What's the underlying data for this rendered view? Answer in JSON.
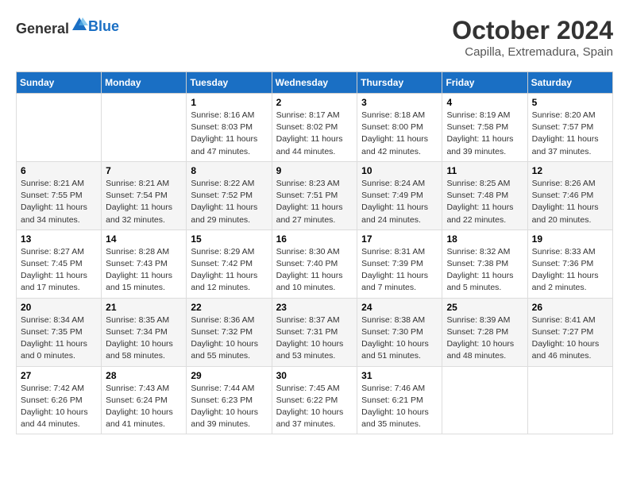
{
  "header": {
    "logo_general": "General",
    "logo_blue": "Blue",
    "month": "October 2024",
    "location": "Capilla, Extremadura, Spain"
  },
  "days_of_week": [
    "Sunday",
    "Monday",
    "Tuesday",
    "Wednesday",
    "Thursday",
    "Friday",
    "Saturday"
  ],
  "weeks": [
    [
      {
        "day": "",
        "sunrise": "",
        "sunset": "",
        "daylight": ""
      },
      {
        "day": "",
        "sunrise": "",
        "sunset": "",
        "daylight": ""
      },
      {
        "day": "1",
        "sunrise": "Sunrise: 8:16 AM",
        "sunset": "Sunset: 8:03 PM",
        "daylight": "Daylight: 11 hours and 47 minutes."
      },
      {
        "day": "2",
        "sunrise": "Sunrise: 8:17 AM",
        "sunset": "Sunset: 8:02 PM",
        "daylight": "Daylight: 11 hours and 44 minutes."
      },
      {
        "day": "3",
        "sunrise": "Sunrise: 8:18 AM",
        "sunset": "Sunset: 8:00 PM",
        "daylight": "Daylight: 11 hours and 42 minutes."
      },
      {
        "day": "4",
        "sunrise": "Sunrise: 8:19 AM",
        "sunset": "Sunset: 7:58 PM",
        "daylight": "Daylight: 11 hours and 39 minutes."
      },
      {
        "day": "5",
        "sunrise": "Sunrise: 8:20 AM",
        "sunset": "Sunset: 7:57 PM",
        "daylight": "Daylight: 11 hours and 37 minutes."
      }
    ],
    [
      {
        "day": "6",
        "sunrise": "Sunrise: 8:21 AM",
        "sunset": "Sunset: 7:55 PM",
        "daylight": "Daylight: 11 hours and 34 minutes."
      },
      {
        "day": "7",
        "sunrise": "Sunrise: 8:21 AM",
        "sunset": "Sunset: 7:54 PM",
        "daylight": "Daylight: 11 hours and 32 minutes."
      },
      {
        "day": "8",
        "sunrise": "Sunrise: 8:22 AM",
        "sunset": "Sunset: 7:52 PM",
        "daylight": "Daylight: 11 hours and 29 minutes."
      },
      {
        "day": "9",
        "sunrise": "Sunrise: 8:23 AM",
        "sunset": "Sunset: 7:51 PM",
        "daylight": "Daylight: 11 hours and 27 minutes."
      },
      {
        "day": "10",
        "sunrise": "Sunrise: 8:24 AM",
        "sunset": "Sunset: 7:49 PM",
        "daylight": "Daylight: 11 hours and 24 minutes."
      },
      {
        "day": "11",
        "sunrise": "Sunrise: 8:25 AM",
        "sunset": "Sunset: 7:48 PM",
        "daylight": "Daylight: 11 hours and 22 minutes."
      },
      {
        "day": "12",
        "sunrise": "Sunrise: 8:26 AM",
        "sunset": "Sunset: 7:46 PM",
        "daylight": "Daylight: 11 hours and 20 minutes."
      }
    ],
    [
      {
        "day": "13",
        "sunrise": "Sunrise: 8:27 AM",
        "sunset": "Sunset: 7:45 PM",
        "daylight": "Daylight: 11 hours and 17 minutes."
      },
      {
        "day": "14",
        "sunrise": "Sunrise: 8:28 AM",
        "sunset": "Sunset: 7:43 PM",
        "daylight": "Daylight: 11 hours and 15 minutes."
      },
      {
        "day": "15",
        "sunrise": "Sunrise: 8:29 AM",
        "sunset": "Sunset: 7:42 PM",
        "daylight": "Daylight: 11 hours and 12 minutes."
      },
      {
        "day": "16",
        "sunrise": "Sunrise: 8:30 AM",
        "sunset": "Sunset: 7:40 PM",
        "daylight": "Daylight: 11 hours and 10 minutes."
      },
      {
        "day": "17",
        "sunrise": "Sunrise: 8:31 AM",
        "sunset": "Sunset: 7:39 PM",
        "daylight": "Daylight: 11 hours and 7 minutes."
      },
      {
        "day": "18",
        "sunrise": "Sunrise: 8:32 AM",
        "sunset": "Sunset: 7:38 PM",
        "daylight": "Daylight: 11 hours and 5 minutes."
      },
      {
        "day": "19",
        "sunrise": "Sunrise: 8:33 AM",
        "sunset": "Sunset: 7:36 PM",
        "daylight": "Daylight: 11 hours and 2 minutes."
      }
    ],
    [
      {
        "day": "20",
        "sunrise": "Sunrise: 8:34 AM",
        "sunset": "Sunset: 7:35 PM",
        "daylight": "Daylight: 11 hours and 0 minutes."
      },
      {
        "day": "21",
        "sunrise": "Sunrise: 8:35 AM",
        "sunset": "Sunset: 7:34 PM",
        "daylight": "Daylight: 10 hours and 58 minutes."
      },
      {
        "day": "22",
        "sunrise": "Sunrise: 8:36 AM",
        "sunset": "Sunset: 7:32 PM",
        "daylight": "Daylight: 10 hours and 55 minutes."
      },
      {
        "day": "23",
        "sunrise": "Sunrise: 8:37 AM",
        "sunset": "Sunset: 7:31 PM",
        "daylight": "Daylight: 10 hours and 53 minutes."
      },
      {
        "day": "24",
        "sunrise": "Sunrise: 8:38 AM",
        "sunset": "Sunset: 7:30 PM",
        "daylight": "Daylight: 10 hours and 51 minutes."
      },
      {
        "day": "25",
        "sunrise": "Sunrise: 8:39 AM",
        "sunset": "Sunset: 7:28 PM",
        "daylight": "Daylight: 10 hours and 48 minutes."
      },
      {
        "day": "26",
        "sunrise": "Sunrise: 8:41 AM",
        "sunset": "Sunset: 7:27 PM",
        "daylight": "Daylight: 10 hours and 46 minutes."
      }
    ],
    [
      {
        "day": "27",
        "sunrise": "Sunrise: 7:42 AM",
        "sunset": "Sunset: 6:26 PM",
        "daylight": "Daylight: 10 hours and 44 minutes."
      },
      {
        "day": "28",
        "sunrise": "Sunrise: 7:43 AM",
        "sunset": "Sunset: 6:24 PM",
        "daylight": "Daylight: 10 hours and 41 minutes."
      },
      {
        "day": "29",
        "sunrise": "Sunrise: 7:44 AM",
        "sunset": "Sunset: 6:23 PM",
        "daylight": "Daylight: 10 hours and 39 minutes."
      },
      {
        "day": "30",
        "sunrise": "Sunrise: 7:45 AM",
        "sunset": "Sunset: 6:22 PM",
        "daylight": "Daylight: 10 hours and 37 minutes."
      },
      {
        "day": "31",
        "sunrise": "Sunrise: 7:46 AM",
        "sunset": "Sunset: 6:21 PM",
        "daylight": "Daylight: 10 hours and 35 minutes."
      },
      {
        "day": "",
        "sunrise": "",
        "sunset": "",
        "daylight": ""
      },
      {
        "day": "",
        "sunrise": "",
        "sunset": "",
        "daylight": ""
      }
    ]
  ]
}
